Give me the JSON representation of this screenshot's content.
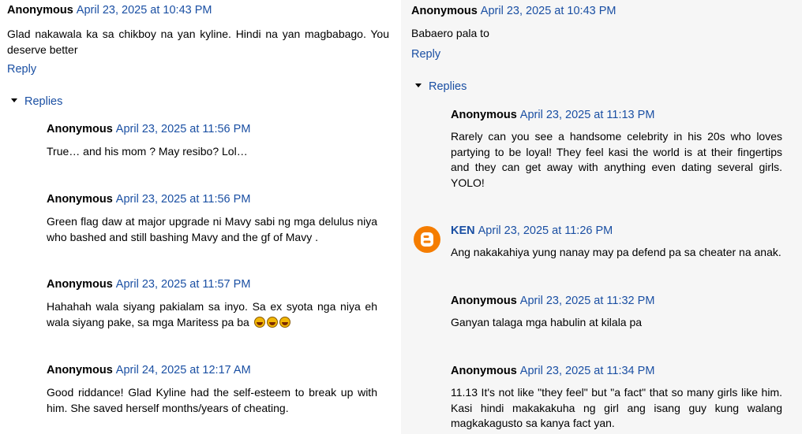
{
  "left": {
    "top": {
      "author": "Anonymous",
      "date": "April 23, 2025 at 10:43 PM",
      "text": "Glad nakawala ka sa chikboy na yan kyline. Hindi na yan magbabago. You deserve better"
    },
    "reply": "Reply",
    "replies_toggle": "Replies",
    "replies": [
      {
        "author": "Anonymous",
        "date": "April 23, 2025 at 11:56 PM",
        "text": "True… and his mom ? May resibo? Lol…"
      },
      {
        "author": "Anonymous",
        "date": "April 23, 2025 at 11:56 PM",
        "text": "Green flag daw at major upgrade ni Mavy sabi ng mga delulus niya who bashed and still bashing Mavy and the gf of Mavy ."
      },
      {
        "author": "Anonymous",
        "date": "April 23, 2025 at 11:57 PM",
        "text": "Hahahah wala siyang pakialam sa inyo. Sa ex syota nga niya eh wala siyang pake, sa mga Maritess pa ba"
      },
      {
        "author": "Anonymous",
        "date": "April 24, 2025 at 12:17 AM",
        "text": "Good riddance! Glad Kyline had the self-esteem to break up with him. She saved herself months/years of cheating."
      }
    ]
  },
  "right": {
    "top": {
      "author": "Anonymous",
      "date": "April 23, 2025 at 10:43 PM",
      "text": "Babaero pala to"
    },
    "reply": "Reply",
    "replies_toggle": "Replies",
    "replies": [
      {
        "author": "Anonymous",
        "date": "April 23, 2025 at 11:13 PM",
        "text": "Rarely can you see a handsome celebrity in his 20s who loves partying to be loyal! They feel kasi the world is at their fingertips and they can get away with anything even dating several girls. YOLO!"
      },
      {
        "author": "KEN",
        "date": "April 23, 2025 at 11:26 PM",
        "text": "Ang nakakahiya yung nanay may pa defend pa sa cheater na anak."
      },
      {
        "author": "Anonymous",
        "date": "April 23, 2025 at 11:32 PM",
        "text": "Ganyan talaga mga habulin at kilala pa"
      },
      {
        "author": "Anonymous",
        "date": "April 23, 2025 at 11:34 PM",
        "text": "11.13 It's not like \"they feel\" but \"a fact\" that so many girls like him. Kasi hindi makakakuha ng girl ang isang guy kung walang magkakagusto sa kanya fact yan."
      }
    ]
  },
  "colors": {
    "link": "#1a4fa3",
    "right_bg": "#f6f6f6",
    "blogger": "#f57d00"
  },
  "icons": {
    "avatar": "blogger-icon",
    "toggle": "triangle-down-icon",
    "emoji": "laughing-face-icon"
  }
}
